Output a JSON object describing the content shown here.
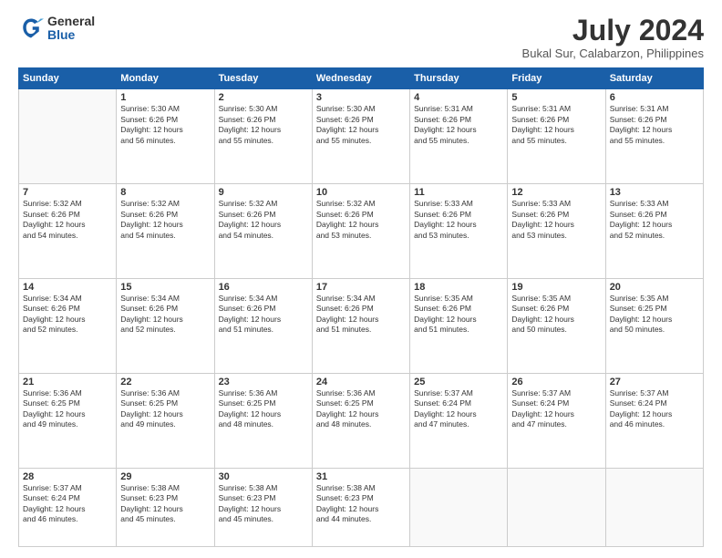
{
  "logo": {
    "general": "General",
    "blue": "Blue"
  },
  "header": {
    "title": "July 2024",
    "subtitle": "Bukal Sur, Calabarzon, Philippines"
  },
  "weekdays": [
    "Sunday",
    "Monday",
    "Tuesday",
    "Wednesday",
    "Thursday",
    "Friday",
    "Saturday"
  ],
  "weeks": [
    [
      {
        "day": "",
        "info": ""
      },
      {
        "day": "1",
        "info": "Sunrise: 5:30 AM\nSunset: 6:26 PM\nDaylight: 12 hours\nand 56 minutes."
      },
      {
        "day": "2",
        "info": "Sunrise: 5:30 AM\nSunset: 6:26 PM\nDaylight: 12 hours\nand 55 minutes."
      },
      {
        "day": "3",
        "info": "Sunrise: 5:30 AM\nSunset: 6:26 PM\nDaylight: 12 hours\nand 55 minutes."
      },
      {
        "day": "4",
        "info": "Sunrise: 5:31 AM\nSunset: 6:26 PM\nDaylight: 12 hours\nand 55 minutes."
      },
      {
        "day": "5",
        "info": "Sunrise: 5:31 AM\nSunset: 6:26 PM\nDaylight: 12 hours\nand 55 minutes."
      },
      {
        "day": "6",
        "info": "Sunrise: 5:31 AM\nSunset: 6:26 PM\nDaylight: 12 hours\nand 55 minutes."
      }
    ],
    [
      {
        "day": "7",
        "info": "Sunrise: 5:32 AM\nSunset: 6:26 PM\nDaylight: 12 hours\nand 54 minutes."
      },
      {
        "day": "8",
        "info": "Sunrise: 5:32 AM\nSunset: 6:26 PM\nDaylight: 12 hours\nand 54 minutes."
      },
      {
        "day": "9",
        "info": "Sunrise: 5:32 AM\nSunset: 6:26 PM\nDaylight: 12 hours\nand 54 minutes."
      },
      {
        "day": "10",
        "info": "Sunrise: 5:32 AM\nSunset: 6:26 PM\nDaylight: 12 hours\nand 53 minutes."
      },
      {
        "day": "11",
        "info": "Sunrise: 5:33 AM\nSunset: 6:26 PM\nDaylight: 12 hours\nand 53 minutes."
      },
      {
        "day": "12",
        "info": "Sunrise: 5:33 AM\nSunset: 6:26 PM\nDaylight: 12 hours\nand 53 minutes."
      },
      {
        "day": "13",
        "info": "Sunrise: 5:33 AM\nSunset: 6:26 PM\nDaylight: 12 hours\nand 52 minutes."
      }
    ],
    [
      {
        "day": "14",
        "info": "Sunrise: 5:34 AM\nSunset: 6:26 PM\nDaylight: 12 hours\nand 52 minutes."
      },
      {
        "day": "15",
        "info": "Sunrise: 5:34 AM\nSunset: 6:26 PM\nDaylight: 12 hours\nand 52 minutes."
      },
      {
        "day": "16",
        "info": "Sunrise: 5:34 AM\nSunset: 6:26 PM\nDaylight: 12 hours\nand 51 minutes."
      },
      {
        "day": "17",
        "info": "Sunrise: 5:34 AM\nSunset: 6:26 PM\nDaylight: 12 hours\nand 51 minutes."
      },
      {
        "day": "18",
        "info": "Sunrise: 5:35 AM\nSunset: 6:26 PM\nDaylight: 12 hours\nand 51 minutes."
      },
      {
        "day": "19",
        "info": "Sunrise: 5:35 AM\nSunset: 6:26 PM\nDaylight: 12 hours\nand 50 minutes."
      },
      {
        "day": "20",
        "info": "Sunrise: 5:35 AM\nSunset: 6:25 PM\nDaylight: 12 hours\nand 50 minutes."
      }
    ],
    [
      {
        "day": "21",
        "info": "Sunrise: 5:36 AM\nSunset: 6:25 PM\nDaylight: 12 hours\nand 49 minutes."
      },
      {
        "day": "22",
        "info": "Sunrise: 5:36 AM\nSunset: 6:25 PM\nDaylight: 12 hours\nand 49 minutes."
      },
      {
        "day": "23",
        "info": "Sunrise: 5:36 AM\nSunset: 6:25 PM\nDaylight: 12 hours\nand 48 minutes."
      },
      {
        "day": "24",
        "info": "Sunrise: 5:36 AM\nSunset: 6:25 PM\nDaylight: 12 hours\nand 48 minutes."
      },
      {
        "day": "25",
        "info": "Sunrise: 5:37 AM\nSunset: 6:24 PM\nDaylight: 12 hours\nand 47 minutes."
      },
      {
        "day": "26",
        "info": "Sunrise: 5:37 AM\nSunset: 6:24 PM\nDaylight: 12 hours\nand 47 minutes."
      },
      {
        "day": "27",
        "info": "Sunrise: 5:37 AM\nSunset: 6:24 PM\nDaylight: 12 hours\nand 46 minutes."
      }
    ],
    [
      {
        "day": "28",
        "info": "Sunrise: 5:37 AM\nSunset: 6:24 PM\nDaylight: 12 hours\nand 46 minutes."
      },
      {
        "day": "29",
        "info": "Sunrise: 5:38 AM\nSunset: 6:23 PM\nDaylight: 12 hours\nand 45 minutes."
      },
      {
        "day": "30",
        "info": "Sunrise: 5:38 AM\nSunset: 6:23 PM\nDaylight: 12 hours\nand 45 minutes."
      },
      {
        "day": "31",
        "info": "Sunrise: 5:38 AM\nSunset: 6:23 PM\nDaylight: 12 hours\nand 44 minutes."
      },
      {
        "day": "",
        "info": ""
      },
      {
        "day": "",
        "info": ""
      },
      {
        "day": "",
        "info": ""
      }
    ]
  ]
}
